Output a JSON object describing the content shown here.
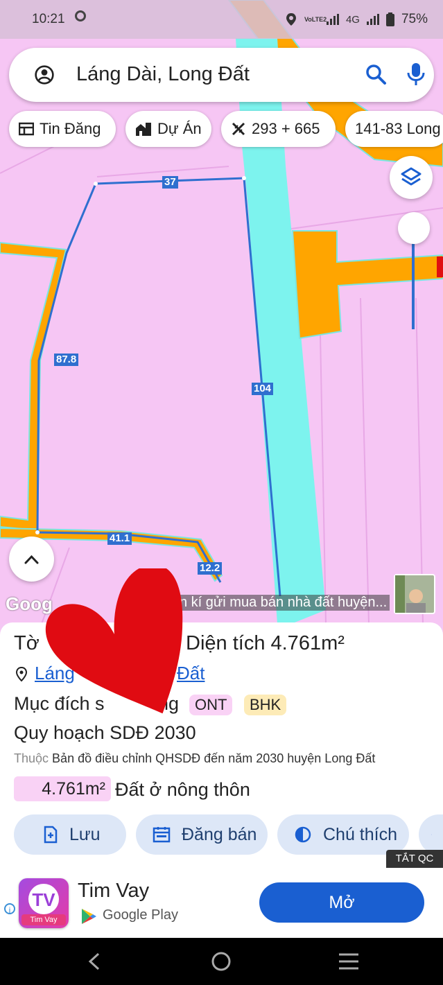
{
  "status_bar": {
    "time": "10:21",
    "network": "4G",
    "battery": "75%",
    "lte_label": "VoLTE2"
  },
  "search": {
    "query": "Láng Dài, Long Đất"
  },
  "chips": [
    {
      "label": "Tin Đăng",
      "icon": "table-icon"
    },
    {
      "label": "Dự Án",
      "icon": "building-icon"
    },
    {
      "label": "293 + 665",
      "icon": "ruler-icon"
    },
    {
      "label": "141-83 Long"
    }
  ],
  "map": {
    "edge_labels": [
      "37",
      "87.8",
      "104",
      "41.1",
      "12.2"
    ],
    "watermark": "Goog",
    "ad_text": "n kí gửi mua bán nhà đất huyện..."
  },
  "parcel": {
    "title_prefix": "Tờ",
    "area_label": "Diện tích 4.761m²",
    "location_prefix": "Láng",
    "location_suffix": "Đất",
    "purpose_prefix": "Mục đích s",
    "purpose_suffix": "ng",
    "tags": [
      {
        "code": "ONT",
        "color": "#f9d2f5"
      },
      {
        "code": "BHK",
        "color": "#fdebb7"
      }
    ],
    "plan": "Quy hoạch SDĐ 2030",
    "belong_prefix": "Thuộc",
    "belong_text": "Bản đồ điều chỉnh QHSDĐ đến năm 2030 huyện Long Đất",
    "area_value": "4.761m²",
    "land_type": "Đất ở nông thôn"
  },
  "actions": [
    {
      "label": "Lưu",
      "icon": "save-icon"
    },
    {
      "label": "Đăng bán",
      "icon": "calendar-icon"
    },
    {
      "label": "Chú thích",
      "icon": "contrast-icon"
    }
  ],
  "ad": {
    "close_label": "TẮT QC",
    "app_name": "Tim Vay",
    "icon_caption": "Tim Vay",
    "store": "Google Play",
    "open_label": "Mở"
  },
  "colors": {
    "residential": "#f6c6f4",
    "water": "#7df3ee",
    "commercial": "#ffa500",
    "parcel_border": "#2f6fcf",
    "accent": "#1a5fd1"
  }
}
